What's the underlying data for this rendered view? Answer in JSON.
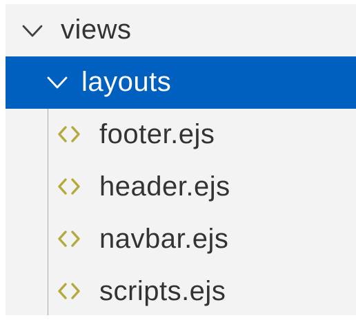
{
  "explorer": {
    "root_folder": {
      "label": "views",
      "icon": "chevron-down-icon",
      "expanded": true
    },
    "subfolder": {
      "label": "layouts",
      "icon": "chevron-down-icon",
      "expanded": true,
      "selected": true
    },
    "files": [
      {
        "label": "footer.ejs",
        "icon": "code-angle-brackets-icon"
      },
      {
        "label": "header.ejs",
        "icon": "code-angle-brackets-icon"
      },
      {
        "label": "navbar.ejs",
        "icon": "code-angle-brackets-icon"
      },
      {
        "label": "scripts.ejs",
        "icon": "code-angle-brackets-icon"
      }
    ]
  },
  "colors": {
    "selection_background": "#0060c0",
    "selection_text": "#ffffff",
    "panel_background": "#f3f3f3",
    "text": "#333333",
    "file_icon": "#b5a93b",
    "indent_guide": "#a9a9a9"
  }
}
